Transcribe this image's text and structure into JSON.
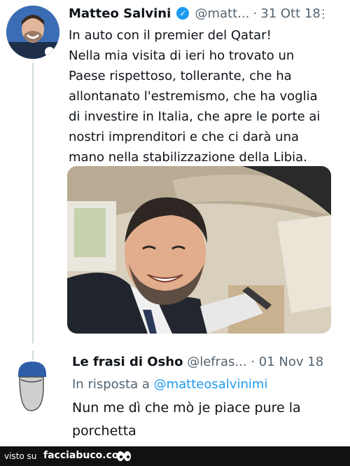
{
  "tweet": {
    "author_name": "Matteo Salvini",
    "handle": "@matt...",
    "separator": "·",
    "date": "31 Ott 18",
    "text": "In auto con il premier del Qatar!\nNella mia visita di ieri ho trovato un\nPaese rispettoso, tollerante, che ha\nallontanato l'estremismo, che ha voglia\ndi investire in Italia, che apre le porte ai\nnostri imprenditori e che ci darà una\nmano nella stabilizzazione della Libia."
  },
  "reply": {
    "author_name": "Le frasi di Osho",
    "handle": "@lefras...",
    "separator": "·",
    "date": "01 Nov 18",
    "in_reply_prefix": "In risposta a",
    "in_reply_mention": "@matteosalvinimi",
    "text": "Nun me dì che mò je piace pure la\nporchetta"
  },
  "footer": {
    "visto_su": "visto su",
    "site": "facciabuco.com"
  },
  "colors": {
    "verified": "#1d9bf0",
    "mention": "#1d9bf0",
    "secondary_text": "#536471",
    "footer_bg": "#111111"
  }
}
